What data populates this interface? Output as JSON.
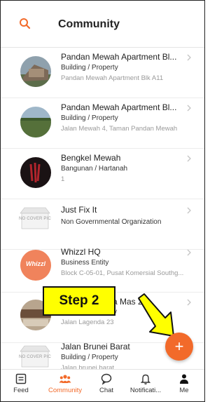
{
  "header": {
    "title": "Community",
    "search_icon": "search-icon"
  },
  "list": [
    {
      "name": "Pandan Mewah Apartment Bl...",
      "type": "Building / Property",
      "address": "Pandan Mewah Apartment Blk A11"
    },
    {
      "name": "Pandan Mewah Apartment Bl...",
      "type": "Building / Property",
      "address": "Jalan Mewah 4, Taman Pandan Mewah"
    },
    {
      "name": "Bengkel Mewah",
      "type": "Bangunan / Hartanah",
      "address": "1"
    },
    {
      "name": "Just Fix It",
      "type": "Non Governmental Organization",
      "address": ""
    },
    {
      "name": "Whizzl HQ",
      "type": "Business Entity",
      "address": "Block C-05-01, Pusat Komersial Southg..."
    },
    {
      "name": "...a Mas 2B",
      "type": "...ty",
      "address": "Jalan Lagenda 23"
    },
    {
      "name": "Jalan Brunei Barat",
      "type": "Building / Property",
      "address": "Jalan brunei barat"
    }
  ],
  "avatars": {
    "whizzl_logo": "Whizzl",
    "no_cover_text": "NO COVER PIC"
  },
  "annotation": {
    "callout": "Step 2"
  },
  "fab": {
    "label": "+"
  },
  "nav": [
    {
      "label": "Feed",
      "icon": "feed-icon"
    },
    {
      "label": "Community",
      "icon": "community-icon"
    },
    {
      "label": "Chat",
      "icon": "chat-icon"
    },
    {
      "label": "Notificati...",
      "icon": "bell-icon"
    },
    {
      "label": "Me",
      "icon": "person-icon"
    }
  ],
  "colors": {
    "accent": "#f26a2a",
    "callout": "#ffff00"
  }
}
